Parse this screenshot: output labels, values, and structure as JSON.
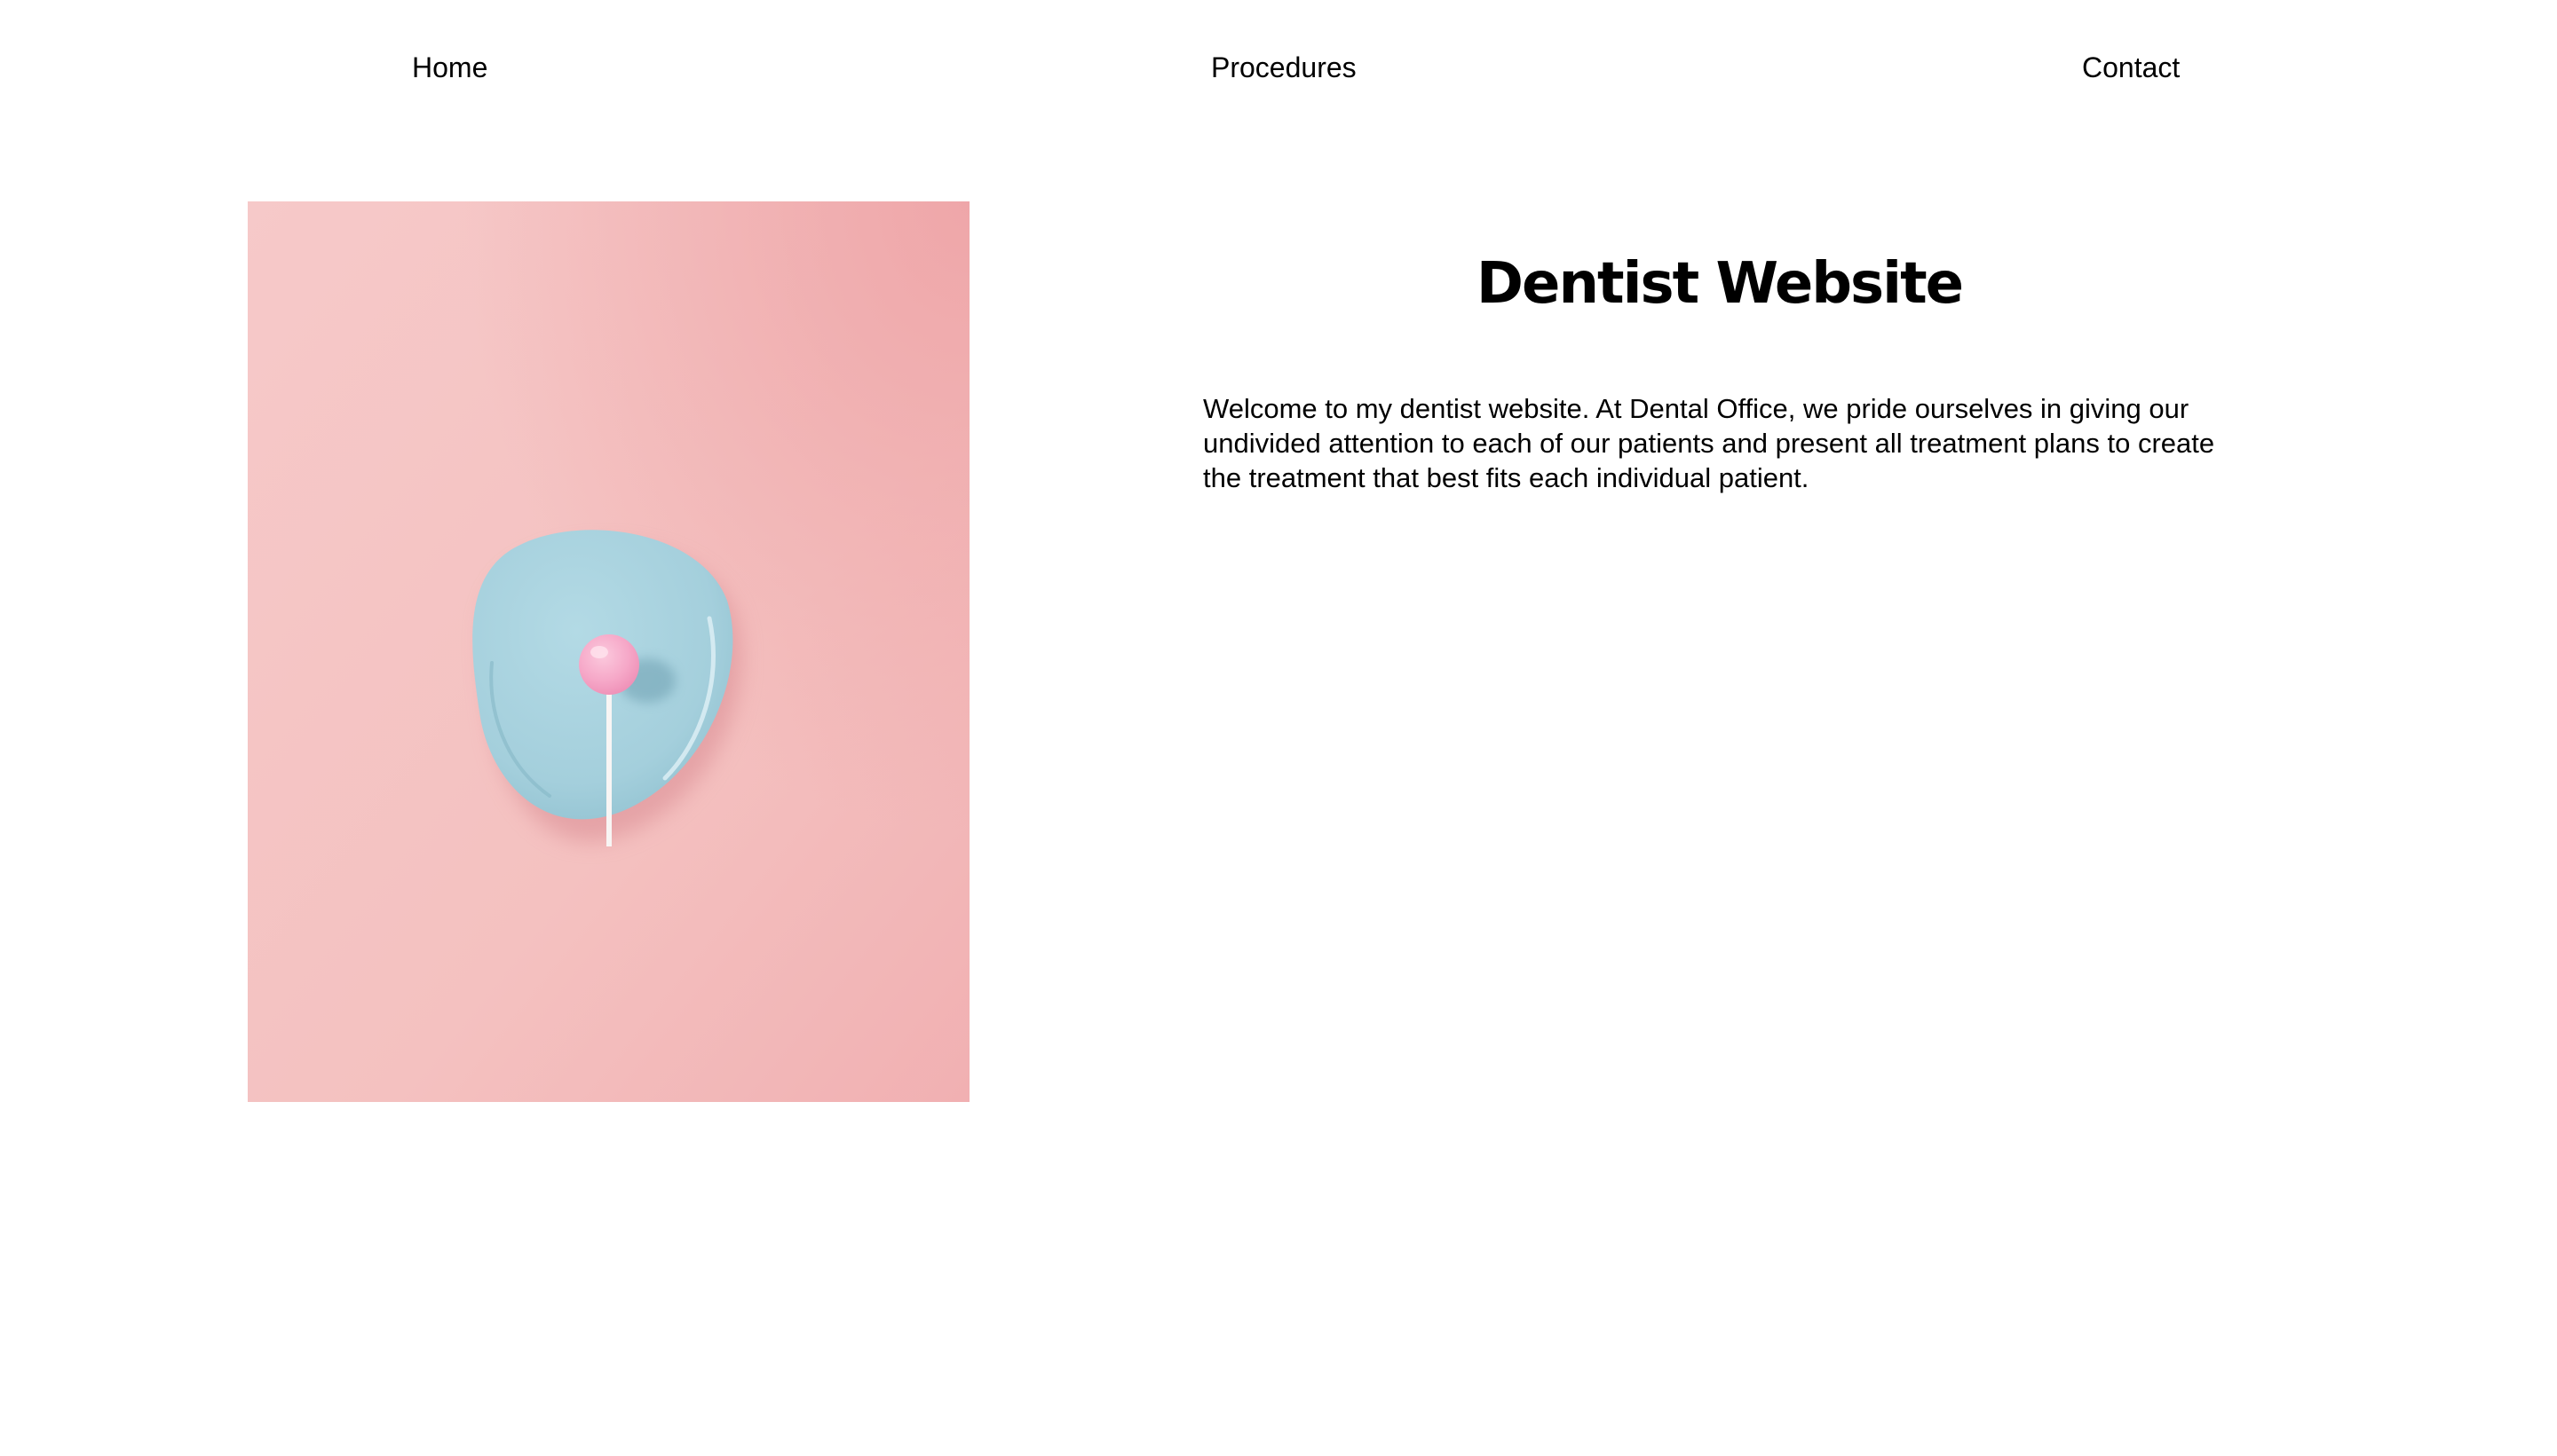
{
  "nav": {
    "home": "Home",
    "procedures": "Procedures",
    "contact": "Contact"
  },
  "hero_image": {
    "alt": "Pink lollipop on a light blue plate against a pink background",
    "background_color": "#f4bfbf",
    "plate_color": "#a9d3df",
    "candy_color": "#f5a3c4"
  },
  "main": {
    "title": "Dentist Website",
    "intro": "Welcome to my dentist website. At Dental Office, we pride ourselves in giving our undivided attention to each of our patients and present all treatment plans to create the treatment that best fits each individual patient."
  }
}
